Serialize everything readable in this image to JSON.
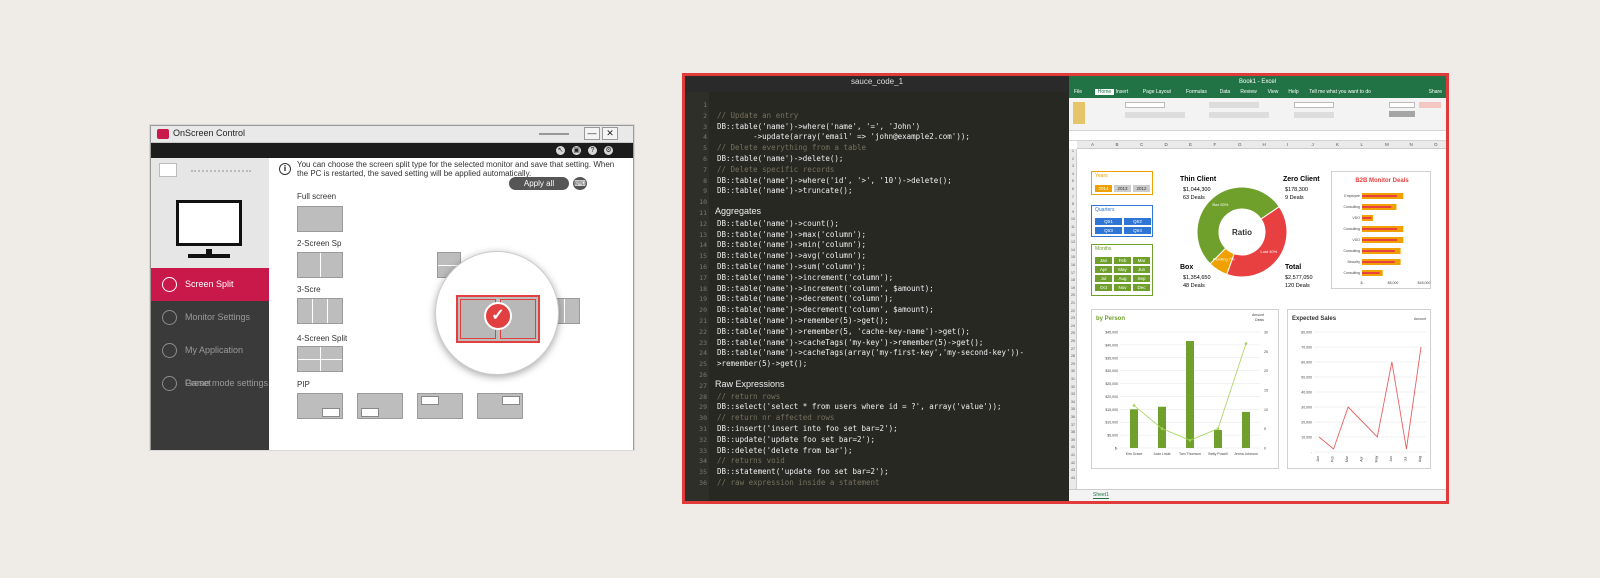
{
  "osc": {
    "title": "OnScreen Control",
    "controls": {
      "minimize": "—",
      "close": "✕"
    },
    "toolbar_icons": [
      "pointer-icon",
      "monitor-icon",
      "help-icon",
      "settings-icon"
    ],
    "toolbar_glyphs": [
      "↖",
      "▣",
      "?",
      "⚙"
    ],
    "sidebar": [
      {
        "label": "Screen Split",
        "active": true
      },
      {
        "label": "Monitor Settings",
        "active": false
      },
      {
        "label": "My Application Preset",
        "active": false
      },
      {
        "label": "Game mode settings",
        "active": false
      }
    ],
    "info_glyph": "i",
    "info_text": "You can choose the screen split type for the selected monitor and save that setting. When the PC is restarted, the saved setting will be applied automatically.",
    "apply_all": "Apply all",
    "sections": {
      "full": "Full screen",
      "two": "2-Screen Sp",
      "three": "3-Scre",
      "four": "4-Screen Split",
      "pip": "PIP"
    },
    "check_glyph": "✓"
  },
  "code": {
    "title": "sauce_code_1",
    "lines": [
      {
        "n": "1",
        "t": ""
      },
      {
        "n": "2",
        "t": "// Update an entry",
        "c": true
      },
      {
        "n": "3",
        "t": "DB::table('name')->where('name', '=', 'John')"
      },
      {
        "n": "4",
        "t": "        ->update(array('email' => 'john@example2.com'));"
      },
      {
        "n": "5",
        "t": "// Delete everything from a table",
        "c": true
      },
      {
        "n": "6",
        "t": "DB::table('name')->delete();"
      },
      {
        "n": "7",
        "t": "// Delete specific records",
        "c": true
      },
      {
        "n": "8",
        "t": "DB::table('name')->where('id', '>', '10')->delete();"
      },
      {
        "n": "9",
        "t": "DB::table('name')->truncate();"
      },
      {
        "n": "10",
        "t": ""
      },
      {
        "n": "11",
        "t": "",
        "h": "Aggregates"
      },
      {
        "n": "12",
        "t": "DB::table('name')->count();"
      },
      {
        "n": "13",
        "t": "DB::table('name')->max('column');"
      },
      {
        "n": "14",
        "t": "DB::table('name')->min('column');"
      },
      {
        "n": "15",
        "t": "DB::table('name')->avg('column');"
      },
      {
        "n": "16",
        "t": "DB::table('name')->sum('column');"
      },
      {
        "n": "17",
        "t": "DB::table('name')->increment('column');"
      },
      {
        "n": "18",
        "t": "DB::table('name')->increment('column', $amount);"
      },
      {
        "n": "19",
        "t": "DB::table('name')->decrement('column');"
      },
      {
        "n": "20",
        "t": "DB::table('name')->decrement('column', $amount);"
      },
      {
        "n": "21",
        "t": "DB::table('name')->remember(5)->get();"
      },
      {
        "n": "22",
        "t": "DB::table('name')->remember(5, 'cache-key-name')->get();"
      },
      {
        "n": "23",
        "t": "DB::table('name')->cacheTags('my-key')->remember(5)->get();"
      },
      {
        "n": "24",
        "t": "DB::table('name')->cacheTags(array('my-first-key','my-second-key'))-"
      },
      {
        "n": "25",
        "t": ">remember(5)->get();"
      },
      {
        "n": "26",
        "t": ""
      },
      {
        "n": "27",
        "t": "",
        "h": "Raw Expressions"
      },
      {
        "n": "28",
        "t": "// return rows",
        "c": true
      },
      {
        "n": "29",
        "t": "DB::select('select * from users where id = ?', array('value'));"
      },
      {
        "n": "30",
        "t": "// return nr affected rows",
        "c": true
      },
      {
        "n": "31",
        "t": "DB::insert('insert into foo set bar=2');"
      },
      {
        "n": "32",
        "t": "DB::update('update foo set bar=2');"
      },
      {
        "n": "33",
        "t": "DB::delete('delete from bar');"
      },
      {
        "n": "34",
        "t": "// returns void",
        "c": true
      },
      {
        "n": "35",
        "t": "DB::statement('update foo set bar=2');"
      },
      {
        "n": "36",
        "t": "// raw expression inside a statement",
        "c": true
      }
    ]
  },
  "excel": {
    "title": "Book1 - Excel",
    "menu": [
      "File",
      "Home",
      "Insert",
      "Page Layout",
      "Formulas",
      "Data",
      "Review",
      "View",
      "Help",
      "Tell me what you want to do"
    ],
    "share": "Share",
    "columns": [
      "A",
      "B",
      "C",
      "D",
      "E",
      "F",
      "G",
      "H",
      "I",
      "J",
      "K",
      "L",
      "M",
      "N",
      "O"
    ],
    "sheet_tab": "Sheet1",
    "slicers": {
      "years": {
        "title": "Years",
        "items": [
          "2014",
          "2013",
          "2012"
        ]
      },
      "quarters": {
        "title": "Quarters",
        "items": [
          "Qtr1",
          "Qtr2",
          "Qtr3",
          "Qtr4"
        ]
      },
      "months": {
        "title": "Months",
        "items": [
          "Jan",
          "Feb",
          "Mar",
          "Apr",
          "May",
          "Jun",
          "Jul",
          "Aug",
          "Sep",
          "Oct",
          "Nov",
          "Dec"
        ]
      }
    },
    "kpi": {
      "thin": {
        "title": "Thin Client",
        "v": "$1,044,300",
        "d": "63 Deals"
      },
      "zero": {
        "title": "Zero Client",
        "v": "$178,300",
        "d": "9 Deals"
      },
      "box": {
        "title": "Box",
        "v": "$1,354,650",
        "d": "48 Deals"
      },
      "total": {
        "title": "Total",
        "v": "$2,577,050",
        "d": "120 Deals"
      },
      "ratio": "Ratio"
    },
    "colors": {
      "green": "#70a02c",
      "red": "#e84040",
      "orange": "#f0a000",
      "blue": "#2e75d6"
    }
  },
  "chart_data": [
    {
      "type": "pie",
      "title": "Ratio",
      "categories": [
        "Box",
        "Thin Client",
        "Zero Client"
      ],
      "values": [
        53,
        40,
        7
      ],
      "labels": [
        "Box 53%",
        "Lost 40%",
        "Pending 7%"
      ]
    },
    {
      "type": "bar",
      "title": "B2B Monitor Deals",
      "categories": [
        "Employee",
        "Consulting",
        "VDO",
        "Consulting",
        "VDO",
        "Consulting",
        "Security",
        "Consulting"
      ],
      "values": [
        30000,
        25000,
        8000,
        30000,
        30000,
        28000,
        28000,
        15000
      ],
      "xlabel_ticks": [
        "$-",
        "$5,000",
        "$45,000"
      ]
    },
    {
      "type": "bar",
      "title": "by Person",
      "categories": [
        "Kim Grace",
        "Juan Linde",
        "Tom Thomson",
        "Betty Powell",
        "Jenna Johnson"
      ],
      "series": [
        {
          "name": "Amount",
          "values": [
            15000,
            16000,
            41500,
            7000,
            14000
          ]
        },
        {
          "name": "Deals",
          "values": [
            11,
            5,
            2,
            5,
            27
          ]
        }
      ],
      "ylim": [
        0,
        45000
      ],
      "y_ticks": [
        "$-",
        "$5,000",
        "$10,000",
        "$15,000",
        "$20,000",
        "$25,000",
        "$30,000",
        "$35,000",
        "$40,000",
        "$45,000"
      ],
      "y2_ticks": [
        "0",
        "5",
        "10",
        "15",
        "20",
        "25",
        "30"
      ]
    },
    {
      "type": "line",
      "title": "Expected Sales",
      "categories": [
        "Jan",
        "Feb",
        "Mar",
        "Apr",
        "May",
        "Jun",
        "Jul",
        "Aug"
      ],
      "series": [
        {
          "name": "Amount",
          "values": [
            10000,
            2000,
            30000,
            20000,
            10000,
            60000,
            2000,
            70000
          ]
        }
      ],
      "ylim": [
        0,
        80000
      ],
      "y_ticks": [
        "-",
        "10,000",
        "20,000",
        "30,000",
        "40,000",
        "50,000",
        "60,000",
        "70,000",
        "80,000"
      ]
    }
  ]
}
